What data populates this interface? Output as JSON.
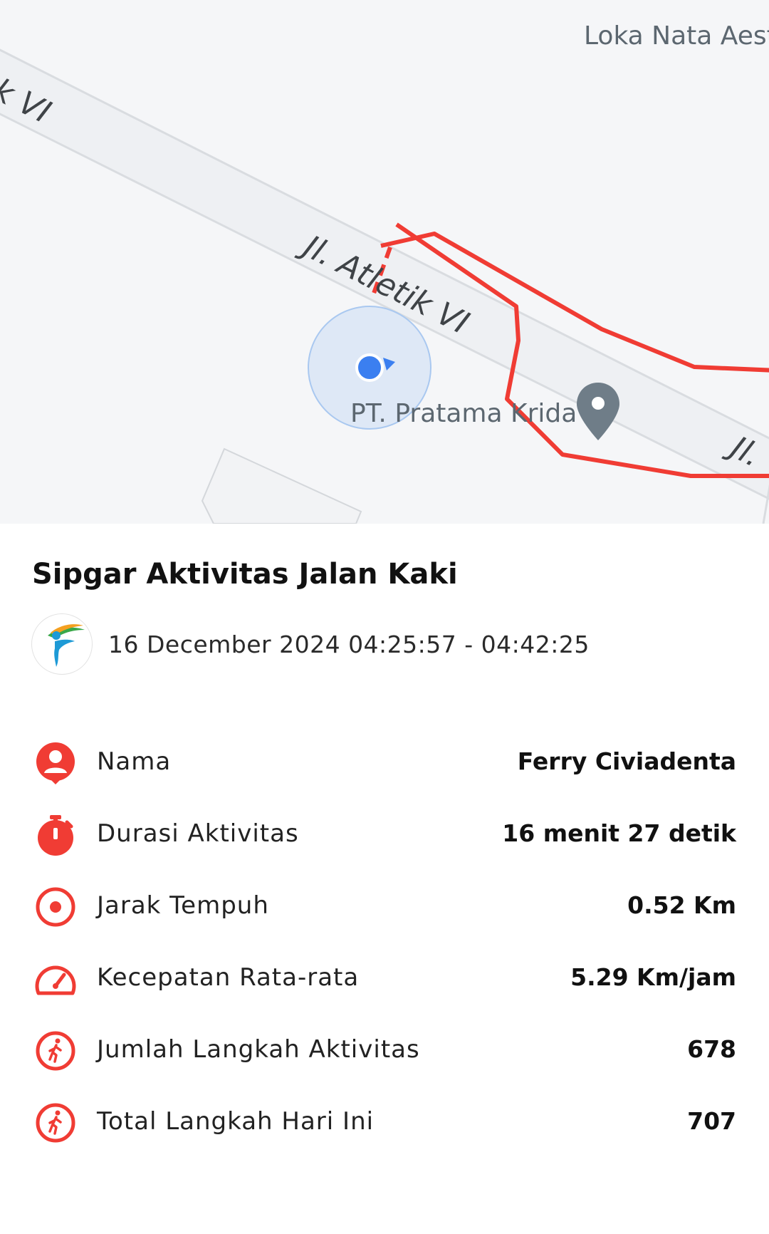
{
  "map": {
    "road_label_1": "k VI",
    "road_label_2": "Jl. Atletik VI",
    "road_label_3": "Jl.",
    "place_top": "Loka Nata Aest",
    "place_poi": "PT. Pratama Krida",
    "route_color": "#f03c34",
    "location_color": "#3b7ff0"
  },
  "activity": {
    "title": "Sipgar Aktivitas Jalan Kaki",
    "datetime": "16 December 2024 04:25:57 - 04:42:25"
  },
  "stats": [
    {
      "label": "Nama",
      "value": "Ferry Civiadenta",
      "icon": "user-pin-icon"
    },
    {
      "label": "Durasi Aktivitas",
      "value": "16 menit 27 detik",
      "icon": "stopwatch-icon"
    },
    {
      "label": "Jarak Tempuh",
      "value": "0.52 Km",
      "icon": "target-icon"
    },
    {
      "label": "Kecepatan Rata-rata",
      "value": "5.29 Km/jam",
      "icon": "speedometer-icon"
    },
    {
      "label": "Jumlah Langkah Aktivitas",
      "value": "678",
      "icon": "walking-icon"
    },
    {
      "label": "Total Langkah Hari Ini",
      "value": "707",
      "icon": "walking-icon"
    }
  ],
  "colors": {
    "accent": "#f03c34"
  }
}
